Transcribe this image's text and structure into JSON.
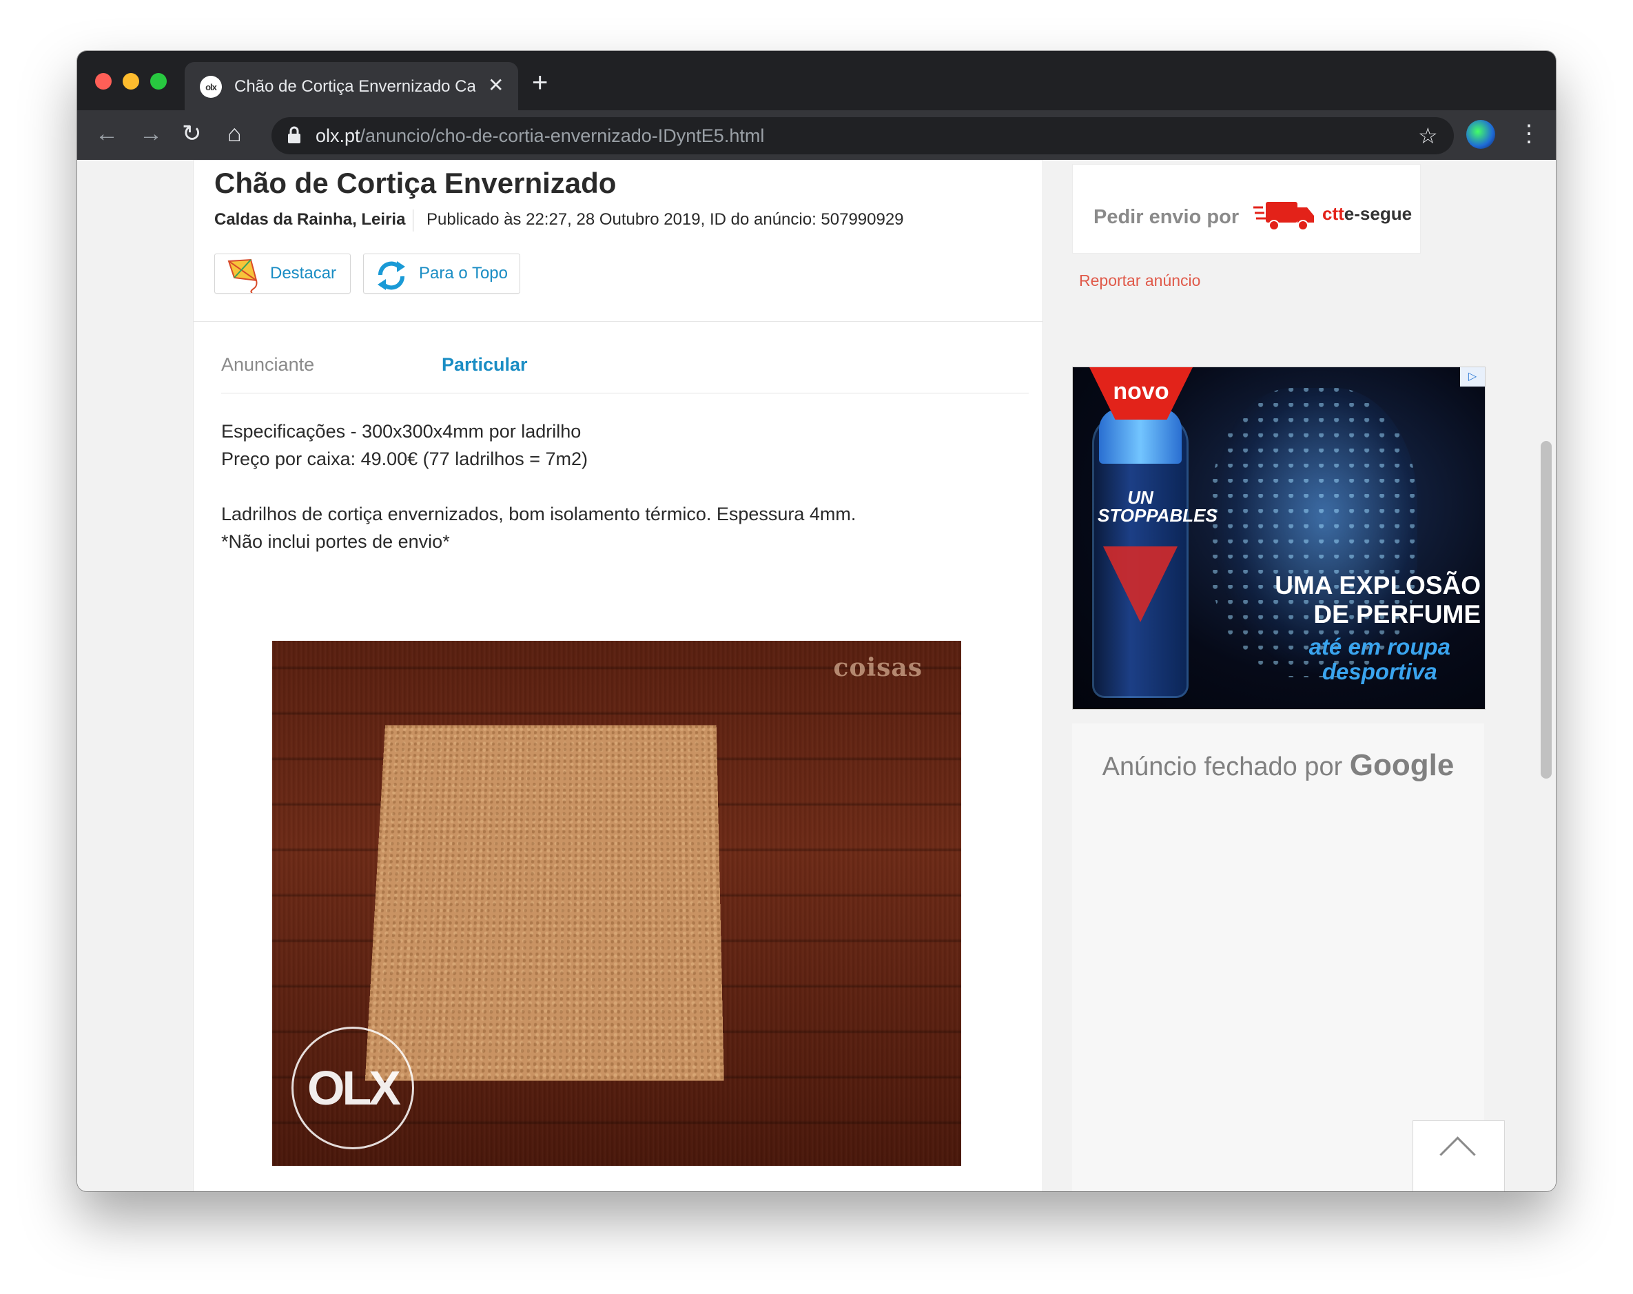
{
  "browser": {
    "tab_title": "Chão de Cortiça Envernizado Caldas da Rainha",
    "tab_favicon": "olx",
    "tab_close": "✕",
    "new_tab": "+",
    "url_host": "olx.pt",
    "url_path": "/anuncio/cho-de-cortia-envernizado-IDyntE5.html",
    "icons": {
      "back": "←",
      "forward": "→",
      "reload": "↻",
      "home": "⌂",
      "lock": "🔒",
      "star": "☆",
      "menu": "⋮"
    }
  },
  "listing": {
    "title": "Chão de Cortiça Envernizado",
    "location": "Caldas da Rainha, Leiria",
    "published": "Publicado às 22:27, 28 Outubro 2019, ID do anúncio: 507990929",
    "actions": {
      "highlight_label": "Destacar",
      "to_top_label": "Para o Topo"
    },
    "params": [
      {
        "label": "Anunciante",
        "value": "Particular"
      }
    ],
    "description": [
      "Especificações - 300x300x4mm por ladrilho",
      "Preço por caixa: 49.00€ (77 ladrilhos = 7m2)",
      "",
      "Ladrilhos de cortiça envernizados, bom isolamento térmico. Espessura 4mm.",
      "*Não inclui portes de envio*"
    ],
    "photo": {
      "watermark_text": "coisas",
      "logo_text": "OLX"
    }
  },
  "sidebar": {
    "shipping_label": "Pedir envio por",
    "ctt_brand_ctt": "ctt",
    "ctt_brand_rest": "e-segue",
    "report_link": "Reportar anúncio",
    "banner": {
      "badge": "▷",
      "novo": "novo",
      "bottle_text": "UN STOPPABLES",
      "headline_1": "UMA EXPLOSÃO",
      "headline_2": "DE PERFUME",
      "subline_1": "até em roupa",
      "subline_2": "desportiva"
    },
    "closed_ad_prefix": "Anúncio fechado por",
    "closed_ad_brand": "Google"
  },
  "colors": {
    "accent_blue": "#1a8dc4",
    "report_red": "#e05a4a",
    "ctt_red": "#e32219"
  }
}
